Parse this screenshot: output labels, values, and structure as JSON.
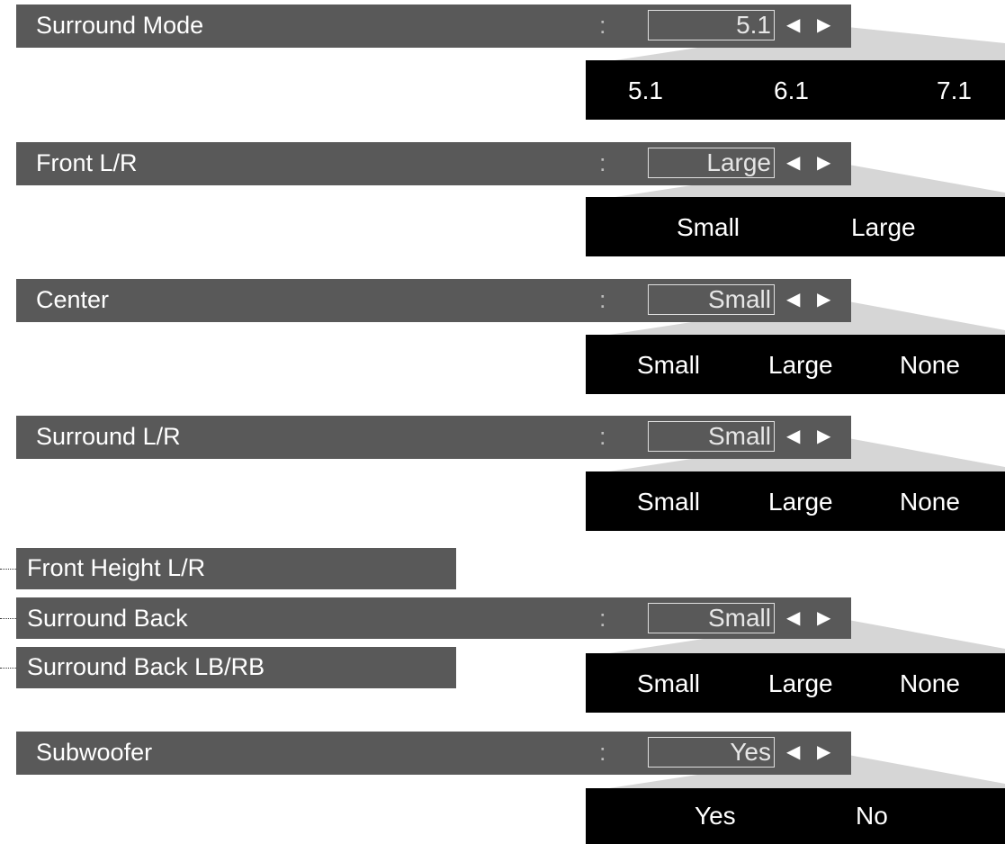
{
  "settings": [
    {
      "label": "Surround Mode",
      "colon": ":",
      "value": "5.1",
      "options": [
        "5.1",
        "6.1",
        "7.1"
      ]
    },
    {
      "label": "Front L/R",
      "colon": ":",
      "value": "Large",
      "options": [
        "Small",
        "Large"
      ]
    },
    {
      "label": "Center",
      "colon": ":",
      "value": "Small",
      "options": [
        "Small",
        "Large",
        "None"
      ]
    },
    {
      "label": "Surround L/R",
      "colon": ":",
      "value": "Small",
      "options": [
        "Small",
        "Large",
        "None"
      ]
    },
    {
      "label": "Surround Back",
      "colon": ":",
      "value": "Small",
      "options": [
        "Small",
        "Large",
        "None"
      ]
    },
    {
      "label": "Subwoofer",
      "colon": ":",
      "value": "Yes",
      "options": [
        "Yes",
        "No"
      ]
    }
  ],
  "sub_items": {
    "front_height": "Front Height L/R",
    "surround_back_lbrb": "Surround Back LB/RB"
  },
  "arrows": {
    "left": "◀",
    "right": "▶"
  },
  "colors": {
    "bar": "#595959",
    "options_panel": "#000000",
    "fan": "#d6d6d6"
  }
}
